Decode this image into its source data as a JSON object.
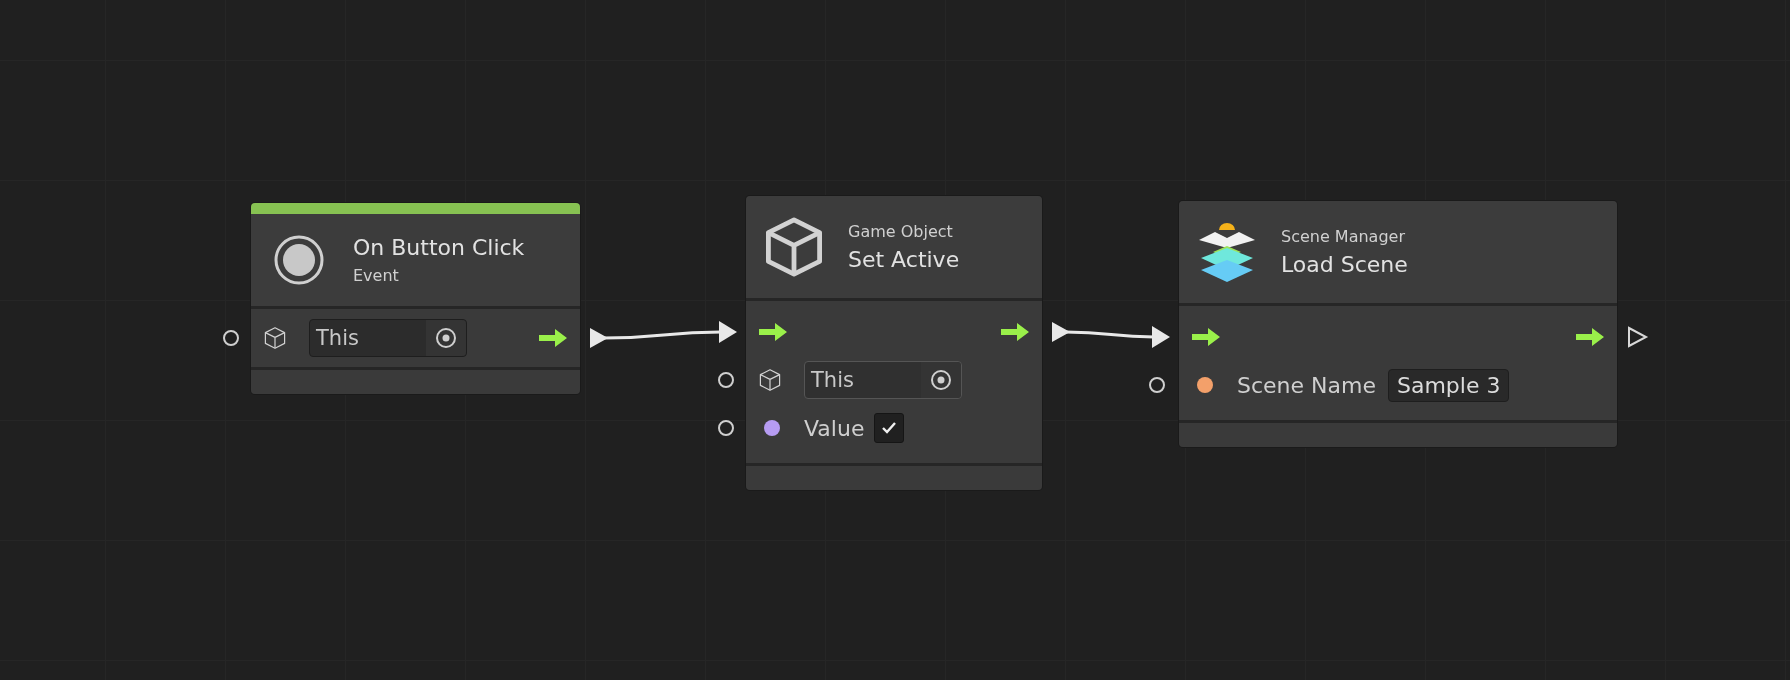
{
  "nodes": [
    {
      "kind": "event",
      "output_connected": true,
      "title": "On Button Click",
      "subtitle": "Event",
      "rows": [
        {
          "kind": "object",
          "value": "This",
          "flow_out": true
        }
      ]
    },
    {
      "kind": "action",
      "output_connected": true,
      "category": "Game Object",
      "title": "Set Active",
      "rows": [
        {
          "kind": "flow",
          "flow_out": true
        },
        {
          "kind": "object",
          "value": "This",
          "flow_out": false
        },
        {
          "kind": "bool",
          "label": "Value",
          "checked": true,
          "color": "#b69cf2",
          "flow_out": false
        }
      ]
    },
    {
      "kind": "scene",
      "output_connected": false,
      "category": "Scene Manager",
      "title": "Load Scene",
      "rows": [
        {
          "kind": "flow",
          "flow_out": true
        },
        {
          "kind": "string",
          "label": "Scene Name",
          "value": "Sample 3",
          "color": "#f3a06a",
          "flow_out": false
        }
      ]
    }
  ]
}
